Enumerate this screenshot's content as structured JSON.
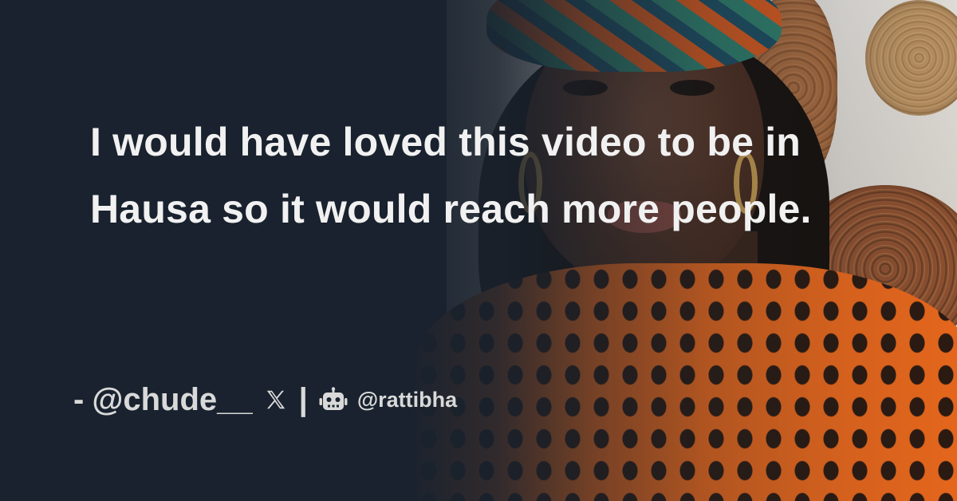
{
  "quote": {
    "text": "I would have loved this video to be in Hausa so it would reach more people."
  },
  "footer": {
    "dash": "-",
    "author_handle": "@chude__",
    "platform_icon": "x-logo-icon",
    "separator": "|",
    "brand_icon": "robot-icon",
    "brand_handle": "@rattibha"
  },
  "colors": {
    "background": "#19222e",
    "text": "#f1f1f1",
    "footer_text": "#d9d9d9",
    "dress_orange": "#e4661c"
  }
}
